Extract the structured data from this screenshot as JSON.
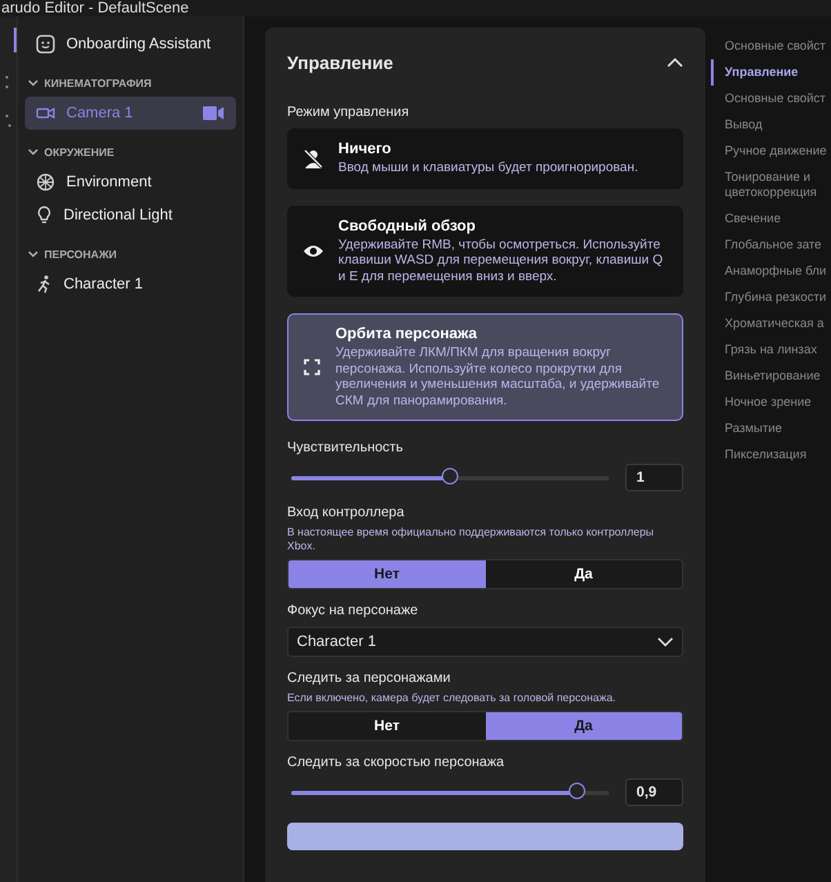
{
  "title_bar": {
    "title": "arudo Editor - DefaultScene"
  },
  "sidebar": {
    "top_item": {
      "label": "Onboarding Assistant"
    },
    "groups": [
      {
        "label": "КИНЕМАТОГРАФИЯ",
        "expanded": true,
        "items": [
          {
            "kind": "camera",
            "label": "Camera 1",
            "selected": true
          }
        ]
      },
      {
        "label": "ОКРУЖЕНИЕ",
        "expanded": true,
        "items": [
          {
            "kind": "environment",
            "label": "Environment",
            "selected": false
          },
          {
            "kind": "light",
            "label": "Directional Light",
            "selected": false
          }
        ]
      },
      {
        "label": "ПЕРСОНАЖИ",
        "expanded": true,
        "items": [
          {
            "kind": "character",
            "label": "Character 1",
            "selected": false
          }
        ]
      }
    ]
  },
  "panel": {
    "title": "Управление",
    "expanded": true,
    "mode_label": "Режим управления",
    "modes": [
      {
        "kind": "none",
        "title": "Ничего",
        "description": "Ввод мыши и клавиатуры будет проигнорирован.",
        "selected": false
      },
      {
        "kind": "free",
        "title": "Свободный обзор",
        "description": "Удерживайте RMB, чтобы осмотреться. Используйте клавиши WASD для перемещения вокруг, клавиши Q и E для перемещения вниз и вверх.",
        "selected": false
      },
      {
        "kind": "orbit",
        "title": "Орбита персонажа",
        "description": "Удерживайте ЛКМ/ПКМ для вращения вокруг персонажа. Используйте колесо прокрутки для увеличения и уменьшения масштаба, и удерживайте СКМ для панорамирования.",
        "selected": true
      }
    ],
    "sensitivity": {
      "label": "Чувствительность",
      "level": 0.5,
      "value": "1"
    },
    "controller": {
      "label": "Вход контроллера",
      "hint": "В настоящее время официально поддерживаются только контроллеры Xbox.",
      "options": [
        {
          "label": "Нет",
          "selected": true
        },
        {
          "label": "Да",
          "selected": false
        }
      ]
    },
    "focus": {
      "label": "Фокус на персонаже",
      "value": "Character 1"
    },
    "follow": {
      "label": "Следить за персонажами",
      "hint": "Если включено, камера будет следовать за головой персонажа.",
      "options": [
        {
          "label": "Нет",
          "selected": false
        },
        {
          "label": "Да",
          "selected": true
        }
      ]
    },
    "follow_speed": {
      "label": "Следить за скоростью персонажа",
      "level": 0.9,
      "value": "0,9"
    }
  },
  "nav": [
    {
      "label": "Основные свойст",
      "selected": false
    },
    {
      "label": "Управление",
      "selected": true
    },
    {
      "label": "Основные свойст",
      "selected": false
    },
    {
      "label": "Вывод",
      "selected": false
    },
    {
      "label": "Ручное движение",
      "selected": false
    },
    {
      "label": "Тонирование и цветокоррекция",
      "selected": false
    },
    {
      "label": "Свечение",
      "selected": false
    },
    {
      "label": "Глобальное зате",
      "selected": false
    },
    {
      "label": "Анаморфные бли",
      "selected": false
    },
    {
      "label": "Глубина резкости",
      "selected": false
    },
    {
      "label": "Хроматическая а",
      "selected": false
    },
    {
      "label": "Грязь на линзах",
      "selected": false
    },
    {
      "label": "Виньетирование",
      "selected": false
    },
    {
      "label": "Ночное зрение",
      "selected": false
    },
    {
      "label": "Размытие",
      "selected": false
    },
    {
      "label": "Пикселизация",
      "selected": false
    }
  ]
}
